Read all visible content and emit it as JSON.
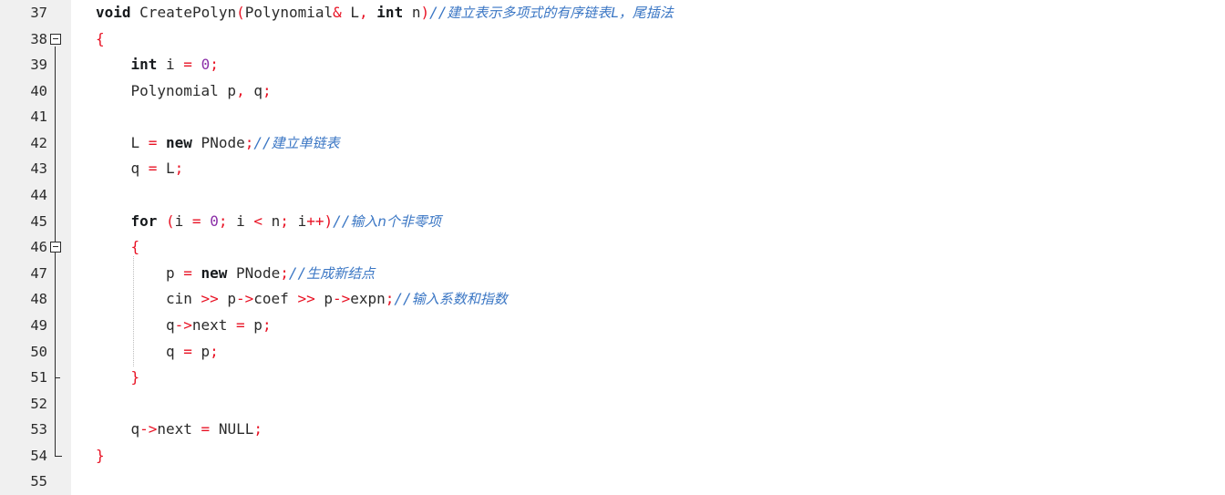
{
  "editor": {
    "language": "C++",
    "gutter_background": "#f0f0f0",
    "code_background": "#ffffff",
    "first_line": 37,
    "last_line": 55,
    "colors": {
      "keyword": "#16191c",
      "operator": "#e81123",
      "number": "#8b2fa8",
      "identifier": "#2b2b2b",
      "comment": "#3a76c4",
      "line_number": "#2b2b2b"
    }
  },
  "line_numbers": [
    "37",
    "38",
    "39",
    "40",
    "41",
    "42",
    "43",
    "44",
    "45",
    "46",
    "47",
    "48",
    "49",
    "50",
    "51",
    "52",
    "53",
    "54",
    "55"
  ],
  "fold_markers": [
    {
      "line": "38",
      "state": "expanded",
      "glyph": "minus-box"
    },
    {
      "line": "46",
      "state": "expanded",
      "glyph": "minus-box"
    }
  ],
  "lines": [
    {
      "number": "37",
      "indent": 0,
      "tokens": [
        {
          "t": "void",
          "c": "kw"
        },
        {
          "t": " ",
          "c": "id"
        },
        {
          "t": "CreatePolyn",
          "c": "id"
        },
        {
          "t": "(",
          "c": "op"
        },
        {
          "t": "Polynomial",
          "c": "id"
        },
        {
          "t": "&",
          "c": "op"
        },
        {
          "t": " L",
          "c": "id"
        },
        {
          "t": ",",
          "c": "op"
        },
        {
          "t": " ",
          "c": "id"
        },
        {
          "t": "int",
          "c": "kw"
        },
        {
          "t": " n",
          "c": "id"
        },
        {
          "t": ")",
          "c": "op"
        },
        {
          "t": "//",
          "c": "cmt-slash"
        },
        {
          "t": "建立表示多项式的有序链表L，尾插法",
          "c": "cmt"
        }
      ]
    },
    {
      "number": "38",
      "indent": 0,
      "tokens": [
        {
          "t": "{",
          "c": "op"
        }
      ]
    },
    {
      "number": "39",
      "indent": 1,
      "tokens": [
        {
          "t": "int",
          "c": "kw"
        },
        {
          "t": " i ",
          "c": "id"
        },
        {
          "t": "=",
          "c": "op"
        },
        {
          "t": " ",
          "c": "id"
        },
        {
          "t": "0",
          "c": "num"
        },
        {
          "t": ";",
          "c": "op"
        }
      ]
    },
    {
      "number": "40",
      "indent": 1,
      "tokens": [
        {
          "t": "Polynomial p",
          "c": "id"
        },
        {
          "t": ",",
          "c": "op"
        },
        {
          "t": " q",
          "c": "id"
        },
        {
          "t": ";",
          "c": "op"
        }
      ]
    },
    {
      "number": "41",
      "indent": 0,
      "tokens": []
    },
    {
      "number": "42",
      "indent": 1,
      "tokens": [
        {
          "t": "L ",
          "c": "id"
        },
        {
          "t": "=",
          "c": "op"
        },
        {
          "t": " ",
          "c": "id"
        },
        {
          "t": "new",
          "c": "kw"
        },
        {
          "t": " PNode",
          "c": "id"
        },
        {
          "t": ";",
          "c": "op"
        },
        {
          "t": "//",
          "c": "cmt-slash"
        },
        {
          "t": "建立单链表",
          "c": "cmt"
        }
      ]
    },
    {
      "number": "43",
      "indent": 1,
      "tokens": [
        {
          "t": "q ",
          "c": "id"
        },
        {
          "t": "=",
          "c": "op"
        },
        {
          "t": " L",
          "c": "id"
        },
        {
          "t": ";",
          "c": "op"
        }
      ]
    },
    {
      "number": "44",
      "indent": 0,
      "tokens": []
    },
    {
      "number": "45",
      "indent": 1,
      "tokens": [
        {
          "t": "for",
          "c": "kw"
        },
        {
          "t": " ",
          "c": "id"
        },
        {
          "t": "(",
          "c": "op"
        },
        {
          "t": "i ",
          "c": "id"
        },
        {
          "t": "=",
          "c": "op"
        },
        {
          "t": " ",
          "c": "id"
        },
        {
          "t": "0",
          "c": "num"
        },
        {
          "t": ";",
          "c": "op"
        },
        {
          "t": " i ",
          "c": "id"
        },
        {
          "t": "<",
          "c": "op"
        },
        {
          "t": " n",
          "c": "id"
        },
        {
          "t": ";",
          "c": "op"
        },
        {
          "t": " i",
          "c": "id"
        },
        {
          "t": "++)",
          "c": "op"
        },
        {
          "t": "//",
          "c": "cmt-slash"
        },
        {
          "t": "输入n个非零项",
          "c": "cmt"
        }
      ]
    },
    {
      "number": "46",
      "indent": 1,
      "tokens": [
        {
          "t": "{",
          "c": "op"
        }
      ]
    },
    {
      "number": "47",
      "indent": 2,
      "tokens": [
        {
          "t": "p ",
          "c": "id"
        },
        {
          "t": "=",
          "c": "op"
        },
        {
          "t": " ",
          "c": "id"
        },
        {
          "t": "new",
          "c": "kw"
        },
        {
          "t": " PNode",
          "c": "id"
        },
        {
          "t": ";",
          "c": "op"
        },
        {
          "t": "//",
          "c": "cmt-slash"
        },
        {
          "t": "生成新结点",
          "c": "cmt"
        }
      ]
    },
    {
      "number": "48",
      "indent": 2,
      "tokens": [
        {
          "t": "cin ",
          "c": "id"
        },
        {
          "t": ">>",
          "c": "op"
        },
        {
          "t": " p",
          "c": "id"
        },
        {
          "t": "->",
          "c": "op"
        },
        {
          "t": "coef ",
          "c": "id"
        },
        {
          "t": ">>",
          "c": "op"
        },
        {
          "t": " p",
          "c": "id"
        },
        {
          "t": "->",
          "c": "op"
        },
        {
          "t": "expn",
          "c": "id"
        },
        {
          "t": ";",
          "c": "op"
        },
        {
          "t": "//",
          "c": "cmt-slash"
        },
        {
          "t": "输入系数和指数",
          "c": "cmt"
        }
      ]
    },
    {
      "number": "49",
      "indent": 2,
      "tokens": [
        {
          "t": "q",
          "c": "id"
        },
        {
          "t": "->",
          "c": "op"
        },
        {
          "t": "next ",
          "c": "id"
        },
        {
          "t": "=",
          "c": "op"
        },
        {
          "t": " p",
          "c": "id"
        },
        {
          "t": ";",
          "c": "op"
        }
      ]
    },
    {
      "number": "50",
      "indent": 2,
      "tokens": [
        {
          "t": "q ",
          "c": "id"
        },
        {
          "t": "=",
          "c": "op"
        },
        {
          "t": " p",
          "c": "id"
        },
        {
          "t": ";",
          "c": "op"
        }
      ]
    },
    {
      "number": "51",
      "indent": 1,
      "tokens": [
        {
          "t": "}",
          "c": "op"
        }
      ]
    },
    {
      "number": "52",
      "indent": 0,
      "tokens": []
    },
    {
      "number": "53",
      "indent": 1,
      "tokens": [
        {
          "t": "q",
          "c": "id"
        },
        {
          "t": "->",
          "c": "op"
        },
        {
          "t": "next ",
          "c": "id"
        },
        {
          "t": "=",
          "c": "op"
        },
        {
          "t": " NULL",
          "c": "id"
        },
        {
          "t": ";",
          "c": "op"
        }
      ]
    },
    {
      "number": "54",
      "indent": 0,
      "tokens": [
        {
          "t": "}",
          "c": "op"
        }
      ]
    },
    {
      "number": "55",
      "indent": 0,
      "tokens": []
    }
  ],
  "indent_guides": [
    {
      "from_line": "46",
      "to_line": "51",
      "indent": 1
    }
  ]
}
